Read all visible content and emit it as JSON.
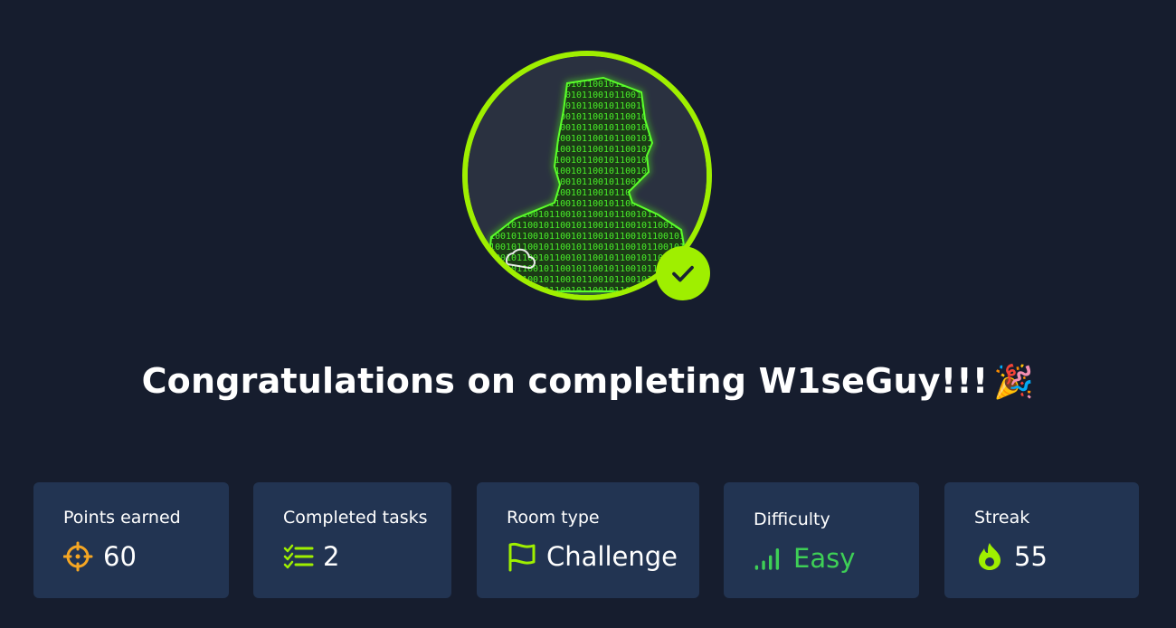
{
  "congrats": {
    "title": "Congratulations on completing W1seGuy!!!",
    "emoji": "🎉"
  },
  "stats": [
    {
      "label": "Points earned",
      "value": "60",
      "icon": "target-icon"
    },
    {
      "label": "Completed tasks",
      "value": "2",
      "icon": "task-list-icon"
    },
    {
      "label": "Room type",
      "value": "Challenge",
      "icon": "flag-icon"
    },
    {
      "label": "Difficulty",
      "value": "Easy",
      "icon": "difficulty-bars-icon"
    },
    {
      "label": "Streak",
      "value": "55",
      "icon": "flame-icon"
    }
  ],
  "colors": {
    "background": "#161d2e",
    "card": "#223452",
    "accent": "#9fef00",
    "easy": "#3ecf56",
    "points_icon": "#f5a623"
  }
}
